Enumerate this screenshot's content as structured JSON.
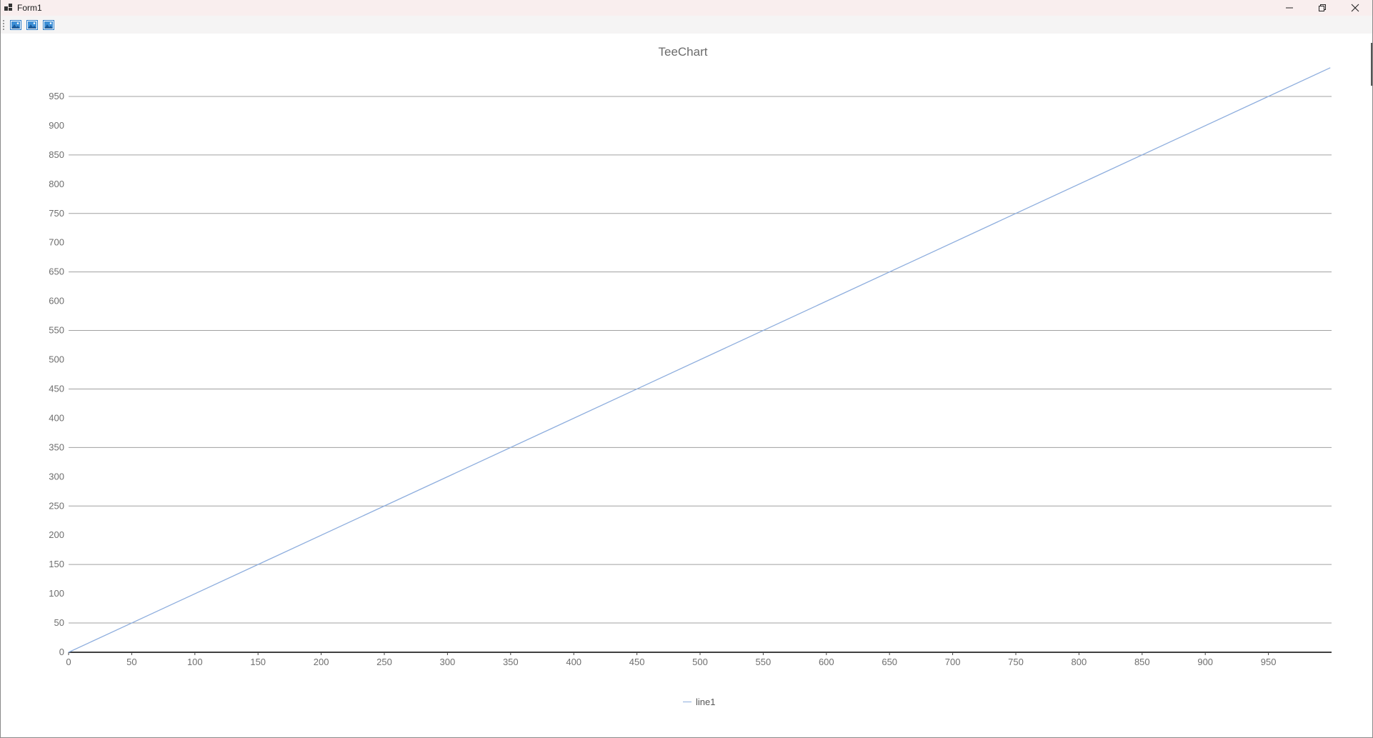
{
  "window": {
    "title": "Form1",
    "minimize_icon": "minimize-icon",
    "maximize_icon": "restore-icon",
    "close_icon": "close-icon"
  },
  "toolbar": {
    "buttons": [
      {
        "icon": "image-icon"
      },
      {
        "icon": "image-icon"
      },
      {
        "icon": "image-icon"
      }
    ]
  },
  "colors": {
    "series_line": "#8eaede",
    "gridline": "#a0a0a0",
    "axis": "#404040",
    "title_bar": "#f9eeee"
  },
  "chart_data": {
    "type": "line",
    "title": "TeeChart",
    "xlabel": "",
    "ylabel": "",
    "xlim": [
      0,
      1000
    ],
    "ylim": [
      0,
      1000
    ],
    "x_ticks": [
      0,
      50,
      100,
      150,
      200,
      250,
      300,
      350,
      400,
      450,
      500,
      550,
      600,
      650,
      700,
      750,
      800,
      850,
      900,
      950
    ],
    "y_ticks": [
      0,
      50,
      100,
      150,
      200,
      250,
      300,
      350,
      400,
      450,
      500,
      550,
      600,
      650,
      700,
      750,
      800,
      850,
      900,
      950
    ],
    "gridlines_y": [
      50,
      150,
      250,
      350,
      450,
      550,
      650,
      750,
      850,
      950
    ],
    "grid": true,
    "legend_position": "bottom",
    "series": [
      {
        "name": "line1",
        "x": [
          0,
          999
        ],
        "y": [
          0,
          999
        ]
      }
    ]
  }
}
